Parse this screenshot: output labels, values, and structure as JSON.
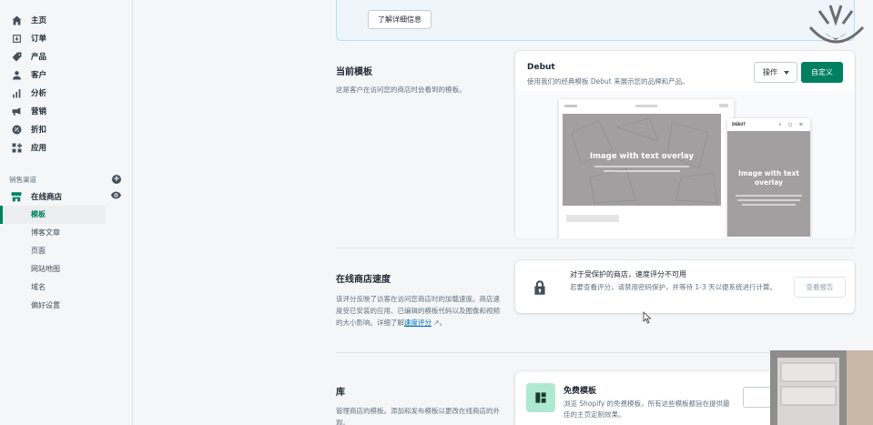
{
  "sidebar": {
    "items": [
      {
        "label": "主页",
        "icon": "home-icon"
      },
      {
        "label": "订单",
        "icon": "orders-icon"
      },
      {
        "label": "产品",
        "icon": "tag-icon"
      },
      {
        "label": "客户",
        "icon": "person-icon"
      },
      {
        "label": "分析",
        "icon": "bar-chart-icon"
      },
      {
        "label": "营销",
        "icon": "megaphone-icon"
      },
      {
        "label": "折扣",
        "icon": "discount-icon"
      },
      {
        "label": "应用",
        "icon": "apps-icon"
      }
    ],
    "channels_heading": "销售渠道",
    "online_store": "在线商店",
    "sub_items": [
      "模板",
      "博客文章",
      "页面",
      "网站地图",
      "域名",
      "偏好设置"
    ]
  },
  "banner": {
    "button": "了解详细信息"
  },
  "current_theme": {
    "title": "当前模板",
    "description": "这是客户在访问您的商店时会看到的模板。",
    "name": "Debut",
    "subtitle": "使用我们的经典模板 Debut 来展示您的品牌和产品。",
    "actions_label": "操作",
    "customize_label": "自定义",
    "preview": {
      "desktop_overlay": "Image with text overlay",
      "mobile_logo": "DEBUT",
      "mobile_overlay": "Image with text overlay"
    }
  },
  "speed": {
    "title": "在线商店速度",
    "description": "该评分反映了访客在访问您商店时的加载速度。商店速度受已安装的应用、已编辑的模板代码以及图像和视频的大小影响。详细了解",
    "link": "速度评分",
    "card_title": "对于受保护的商店，速度评分不可用",
    "card_desc": "若要查看评分，请禁用密码保护，并等待 1-3 天以便系统进行计算。",
    "report_button": "查看报告"
  },
  "library": {
    "title": "库",
    "description": "管理商店的模板。添加和发布模板以更改在线商店的外观。",
    "free_title": "免费模板",
    "free_desc": "浏览 Shopify 的免费模板，所有这些模板都旨在提供最佳的主页定制效果。"
  },
  "colors": {
    "accent": "#008060",
    "banner_bg": "#eef6fb",
    "link": "#006fbb"
  }
}
